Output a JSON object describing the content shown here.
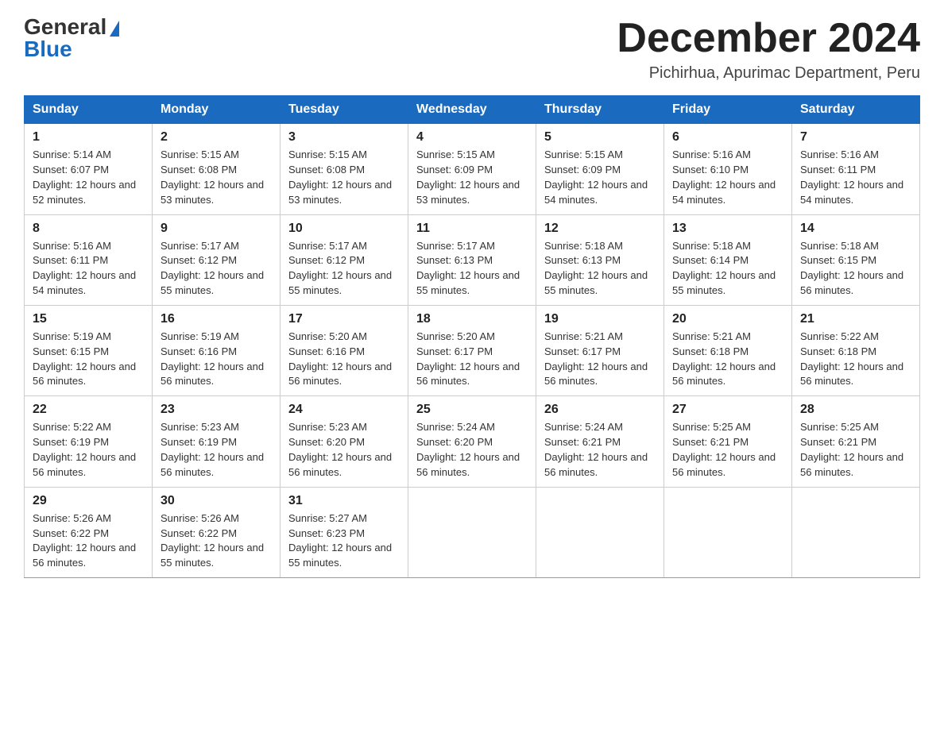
{
  "logo": {
    "text_general": "General",
    "text_blue": "Blue"
  },
  "header": {
    "month_title": "December 2024",
    "location": "Pichirhua, Apurimac Department, Peru"
  },
  "weekdays": [
    "Sunday",
    "Monday",
    "Tuesday",
    "Wednesday",
    "Thursday",
    "Friday",
    "Saturday"
  ],
  "weeks": [
    [
      {
        "day": "1",
        "sunrise": "5:14 AM",
        "sunset": "6:07 PM",
        "daylight": "12 hours and 52 minutes."
      },
      {
        "day": "2",
        "sunrise": "5:15 AM",
        "sunset": "6:08 PM",
        "daylight": "12 hours and 53 minutes."
      },
      {
        "day": "3",
        "sunrise": "5:15 AM",
        "sunset": "6:08 PM",
        "daylight": "12 hours and 53 minutes."
      },
      {
        "day": "4",
        "sunrise": "5:15 AM",
        "sunset": "6:09 PM",
        "daylight": "12 hours and 53 minutes."
      },
      {
        "day": "5",
        "sunrise": "5:15 AM",
        "sunset": "6:09 PM",
        "daylight": "12 hours and 54 minutes."
      },
      {
        "day": "6",
        "sunrise": "5:16 AM",
        "sunset": "6:10 PM",
        "daylight": "12 hours and 54 minutes."
      },
      {
        "day": "7",
        "sunrise": "5:16 AM",
        "sunset": "6:11 PM",
        "daylight": "12 hours and 54 minutes."
      }
    ],
    [
      {
        "day": "8",
        "sunrise": "5:16 AM",
        "sunset": "6:11 PM",
        "daylight": "12 hours and 54 minutes."
      },
      {
        "day": "9",
        "sunrise": "5:17 AM",
        "sunset": "6:12 PM",
        "daylight": "12 hours and 55 minutes."
      },
      {
        "day": "10",
        "sunrise": "5:17 AM",
        "sunset": "6:12 PM",
        "daylight": "12 hours and 55 minutes."
      },
      {
        "day": "11",
        "sunrise": "5:17 AM",
        "sunset": "6:13 PM",
        "daylight": "12 hours and 55 minutes."
      },
      {
        "day": "12",
        "sunrise": "5:18 AM",
        "sunset": "6:13 PM",
        "daylight": "12 hours and 55 minutes."
      },
      {
        "day": "13",
        "sunrise": "5:18 AM",
        "sunset": "6:14 PM",
        "daylight": "12 hours and 55 minutes."
      },
      {
        "day": "14",
        "sunrise": "5:18 AM",
        "sunset": "6:15 PM",
        "daylight": "12 hours and 56 minutes."
      }
    ],
    [
      {
        "day": "15",
        "sunrise": "5:19 AM",
        "sunset": "6:15 PM",
        "daylight": "12 hours and 56 minutes."
      },
      {
        "day": "16",
        "sunrise": "5:19 AM",
        "sunset": "6:16 PM",
        "daylight": "12 hours and 56 minutes."
      },
      {
        "day": "17",
        "sunrise": "5:20 AM",
        "sunset": "6:16 PM",
        "daylight": "12 hours and 56 minutes."
      },
      {
        "day": "18",
        "sunrise": "5:20 AM",
        "sunset": "6:17 PM",
        "daylight": "12 hours and 56 minutes."
      },
      {
        "day": "19",
        "sunrise": "5:21 AM",
        "sunset": "6:17 PM",
        "daylight": "12 hours and 56 minutes."
      },
      {
        "day": "20",
        "sunrise": "5:21 AM",
        "sunset": "6:18 PM",
        "daylight": "12 hours and 56 minutes."
      },
      {
        "day": "21",
        "sunrise": "5:22 AM",
        "sunset": "6:18 PM",
        "daylight": "12 hours and 56 minutes."
      }
    ],
    [
      {
        "day": "22",
        "sunrise": "5:22 AM",
        "sunset": "6:19 PM",
        "daylight": "12 hours and 56 minutes."
      },
      {
        "day": "23",
        "sunrise": "5:23 AM",
        "sunset": "6:19 PM",
        "daylight": "12 hours and 56 minutes."
      },
      {
        "day": "24",
        "sunrise": "5:23 AM",
        "sunset": "6:20 PM",
        "daylight": "12 hours and 56 minutes."
      },
      {
        "day": "25",
        "sunrise": "5:24 AM",
        "sunset": "6:20 PM",
        "daylight": "12 hours and 56 minutes."
      },
      {
        "day": "26",
        "sunrise": "5:24 AM",
        "sunset": "6:21 PM",
        "daylight": "12 hours and 56 minutes."
      },
      {
        "day": "27",
        "sunrise": "5:25 AM",
        "sunset": "6:21 PM",
        "daylight": "12 hours and 56 minutes."
      },
      {
        "day": "28",
        "sunrise": "5:25 AM",
        "sunset": "6:21 PM",
        "daylight": "12 hours and 56 minutes."
      }
    ],
    [
      {
        "day": "29",
        "sunrise": "5:26 AM",
        "sunset": "6:22 PM",
        "daylight": "12 hours and 56 minutes."
      },
      {
        "day": "30",
        "sunrise": "5:26 AM",
        "sunset": "6:22 PM",
        "daylight": "12 hours and 55 minutes."
      },
      {
        "day": "31",
        "sunrise": "5:27 AM",
        "sunset": "6:23 PM",
        "daylight": "12 hours and 55 minutes."
      },
      null,
      null,
      null,
      null
    ]
  ]
}
